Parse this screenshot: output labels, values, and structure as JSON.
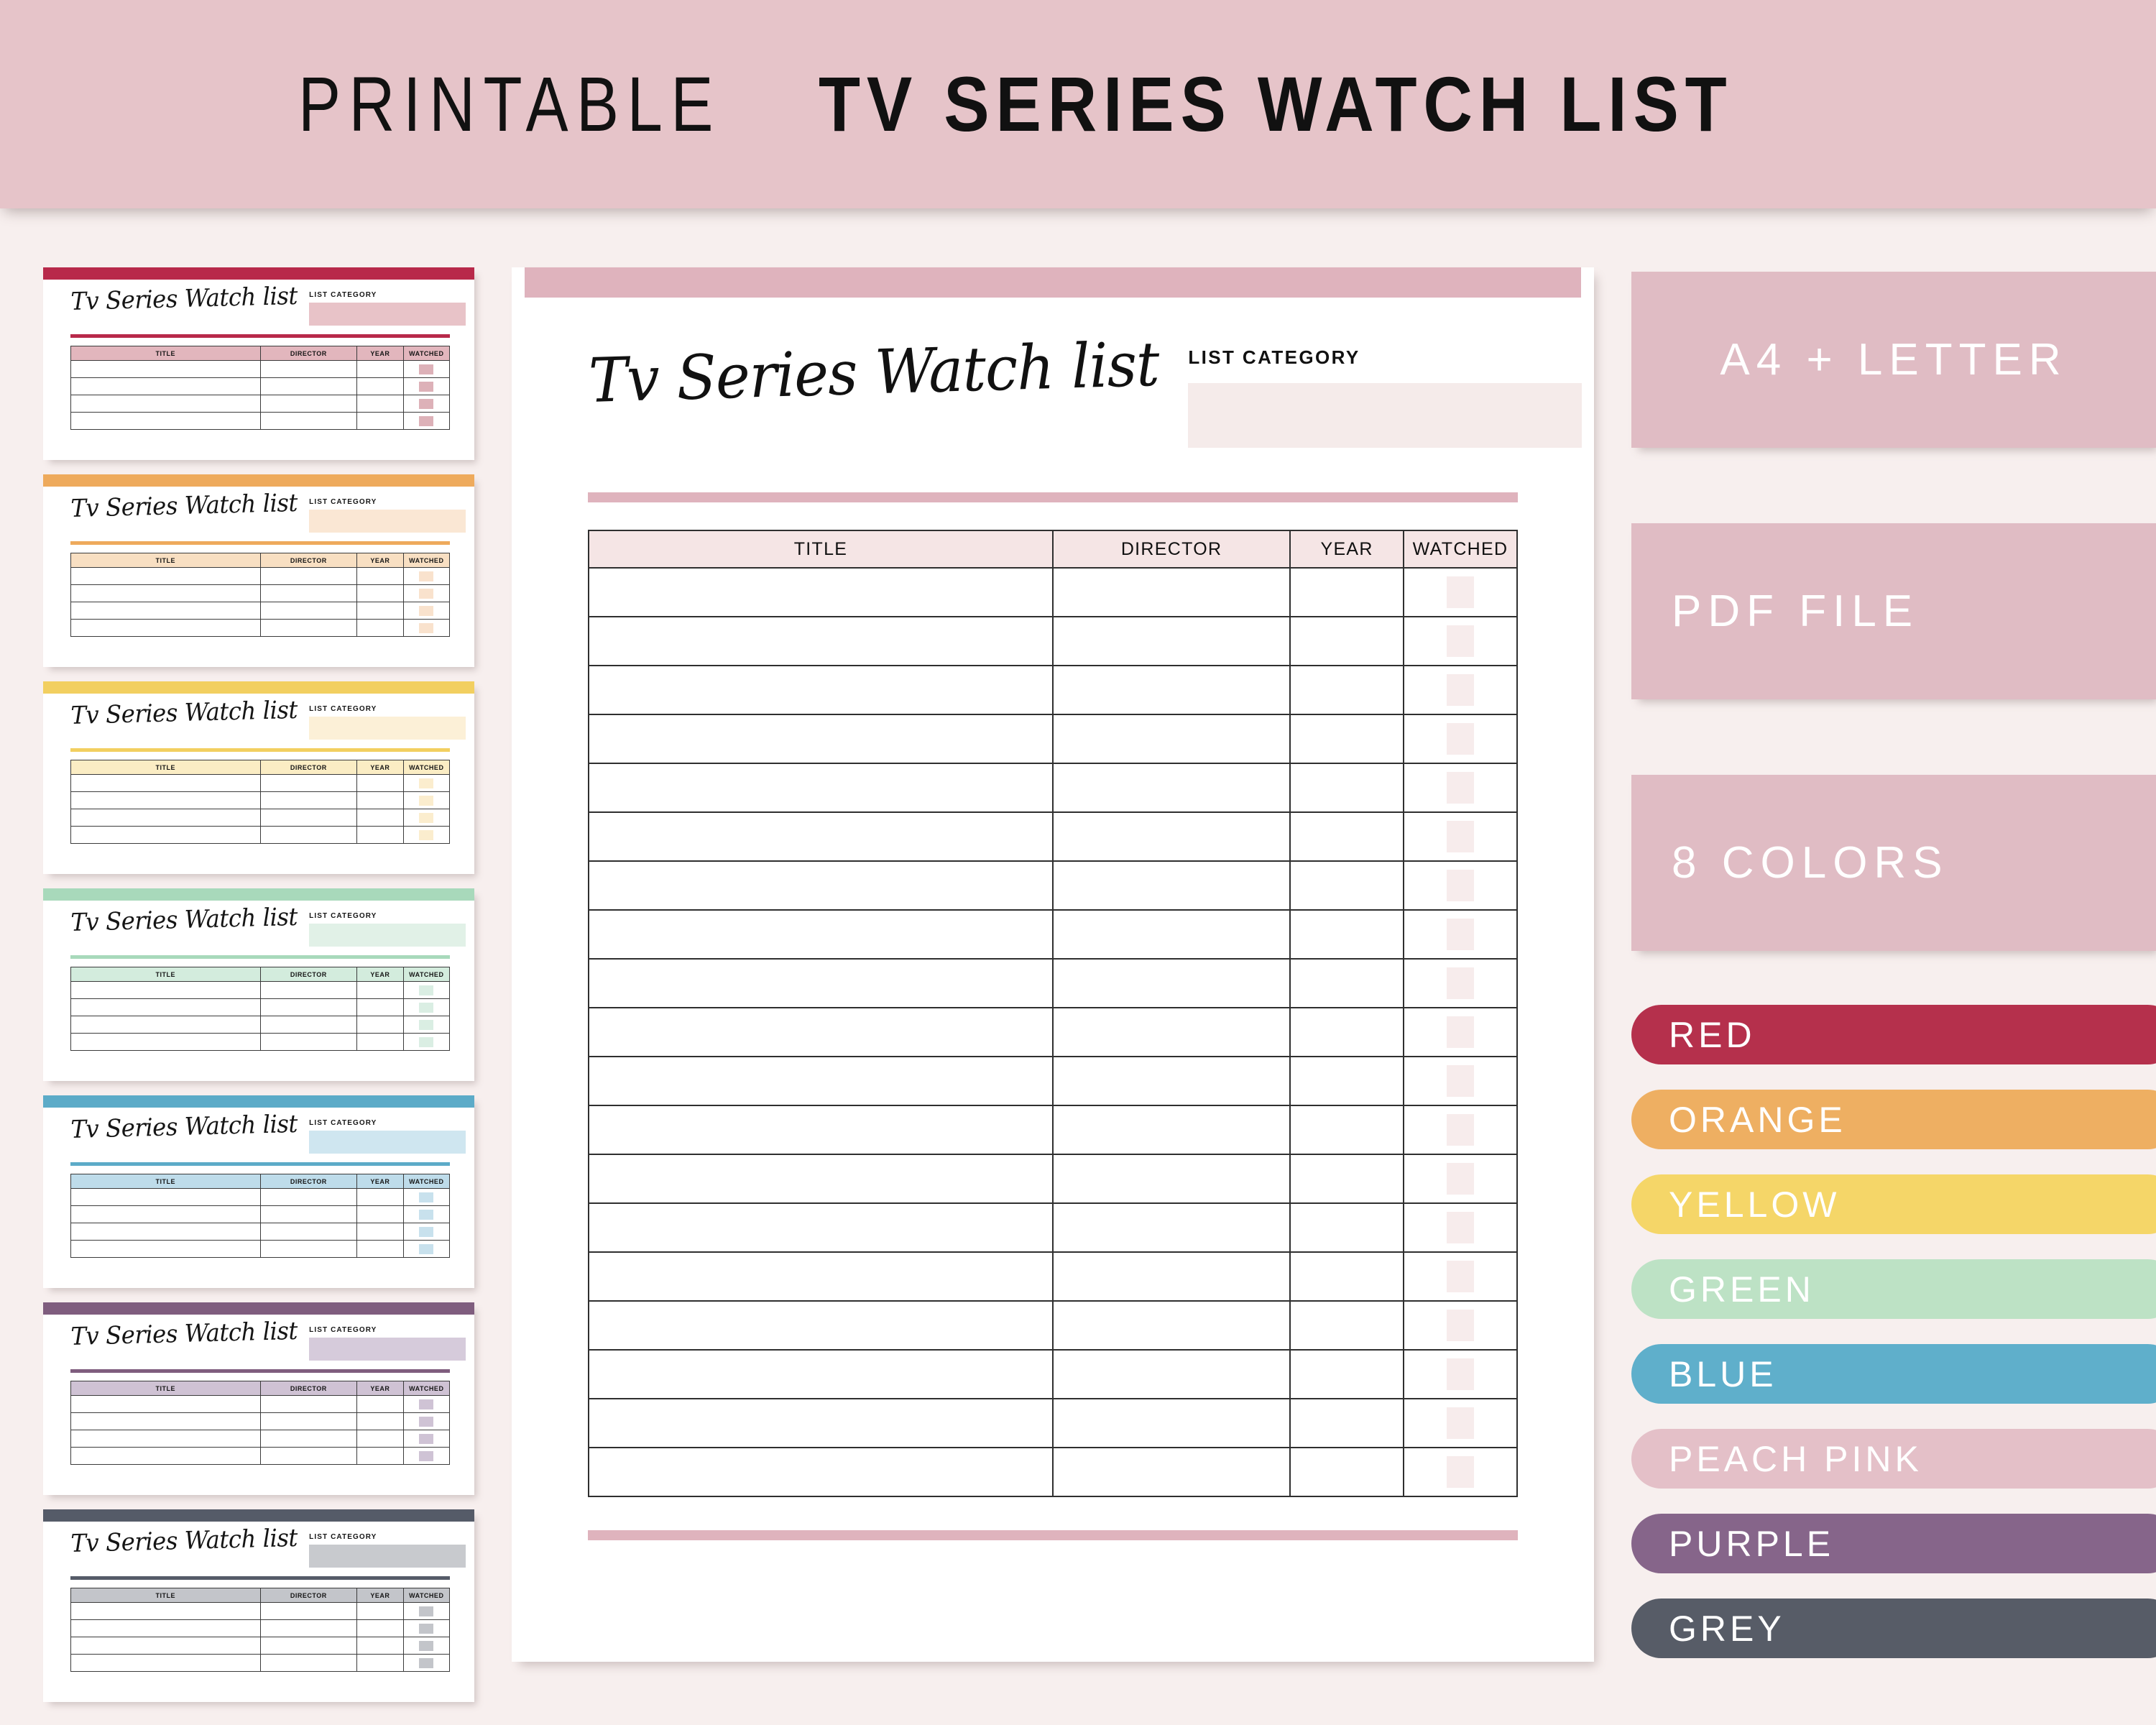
{
  "banner": {
    "title_light": "PRINTABLE",
    "title_bold": "TV SERIES WATCH LIST",
    "background": "#e6c4c9"
  },
  "page_background": "#f7efee",
  "printable": {
    "script_title": "Tv Series Watch list",
    "category_label": "LIST CATEGORY",
    "category_value": "",
    "accent": "#dfb3bd",
    "header_fill": "#f5e5e5",
    "category_box_fill": "#f5ebea",
    "checkbox_fill": "#f7ecec",
    "columns": [
      "TITLE",
      "DIRECTOR",
      "YEAR",
      "WATCHED"
    ],
    "row_count": 19,
    "rows": [
      {
        "title": "",
        "director": "",
        "year": "",
        "watched": ""
      },
      {
        "title": "",
        "director": "",
        "year": "",
        "watched": ""
      },
      {
        "title": "",
        "director": "",
        "year": "",
        "watched": ""
      },
      {
        "title": "",
        "director": "",
        "year": "",
        "watched": ""
      },
      {
        "title": "",
        "director": "",
        "year": "",
        "watched": ""
      },
      {
        "title": "",
        "director": "",
        "year": "",
        "watched": ""
      },
      {
        "title": "",
        "director": "",
        "year": "",
        "watched": ""
      },
      {
        "title": "",
        "director": "",
        "year": "",
        "watched": ""
      },
      {
        "title": "",
        "director": "",
        "year": "",
        "watched": ""
      },
      {
        "title": "",
        "director": "",
        "year": "",
        "watched": ""
      },
      {
        "title": "",
        "director": "",
        "year": "",
        "watched": ""
      },
      {
        "title": "",
        "director": "",
        "year": "",
        "watched": ""
      },
      {
        "title": "",
        "director": "",
        "year": "",
        "watched": ""
      },
      {
        "title": "",
        "director": "",
        "year": "",
        "watched": ""
      },
      {
        "title": "",
        "director": "",
        "year": "",
        "watched": ""
      },
      {
        "title": "",
        "director": "",
        "year": "",
        "watched": ""
      },
      {
        "title": "",
        "director": "",
        "year": "",
        "watched": ""
      },
      {
        "title": "",
        "director": "",
        "year": "",
        "watched": ""
      },
      {
        "title": "",
        "director": "",
        "year": "",
        "watched": ""
      }
    ]
  },
  "thumbnails": [
    {
      "name": "red",
      "bar": "#b8294a",
      "divider": "#b8294a",
      "header_fill": "#e2b6bd",
      "box_fill": "#e8c3c8",
      "check_fill": "#ddb1b8"
    },
    {
      "name": "orange",
      "bar": "#eeaa5c",
      "divider": "#eeaa5c",
      "header_fill": "#f8dfc2",
      "box_fill": "#fae7d4",
      "check_fill": "#f9e2cd"
    },
    {
      "name": "yellow",
      "bar": "#f2cf60",
      "divider": "#f2cf60",
      "header_fill": "#fbedc4",
      "box_fill": "#fcf0d7",
      "check_fill": "#fbedce"
    },
    {
      "name": "green",
      "bar": "#a8d9bb",
      "divider": "#a8d9bb",
      "header_fill": "#d3ecdd",
      "box_fill": "#e1f1e7",
      "check_fill": "#daeee3"
    },
    {
      "name": "blue",
      "bar": "#5cabc8",
      "divider": "#5cabc8",
      "header_fill": "#bedcea",
      "box_fill": "#cfe6f0",
      "check_fill": "#c8e1ed"
    },
    {
      "name": "purple",
      "bar": "#7f5d7e",
      "divider": "#7f5d7e",
      "header_fill": "#cfc2d4",
      "box_fill": "#d6cbdb",
      "check_fill": "#cfc3d5"
    },
    {
      "name": "grey",
      "bar": "#555b68",
      "divider": "#555b68",
      "header_fill": "#c3c5ca",
      "box_fill": "#c8cace",
      "check_fill": "#c3c5ca"
    }
  ],
  "features": [
    {
      "label": "A4 + LETTER",
      "align": "center"
    },
    {
      "label": "PDF FILE",
      "align": "left"
    },
    {
      "label": "8 COLORS",
      "align": "left"
    }
  ],
  "feature_card_color": "#e0bcc4",
  "colors": [
    {
      "label": "RED",
      "hex": "#b5304c"
    },
    {
      "label": "ORANGE",
      "hex": "#eeaf62"
    },
    {
      "label": "YELLOW",
      "hex": "#f5d668"
    },
    {
      "label": "GREEN",
      "hex": "#bde2c5"
    },
    {
      "label": "BLUE",
      "hex": "#5fafcb"
    },
    {
      "label": "PEACH PINK",
      "hex": "#e4c0c8"
    },
    {
      "label": "PURPLE",
      "hex": "#86658a"
    },
    {
      "label": "GREY",
      "hex": "#575c67"
    }
  ]
}
